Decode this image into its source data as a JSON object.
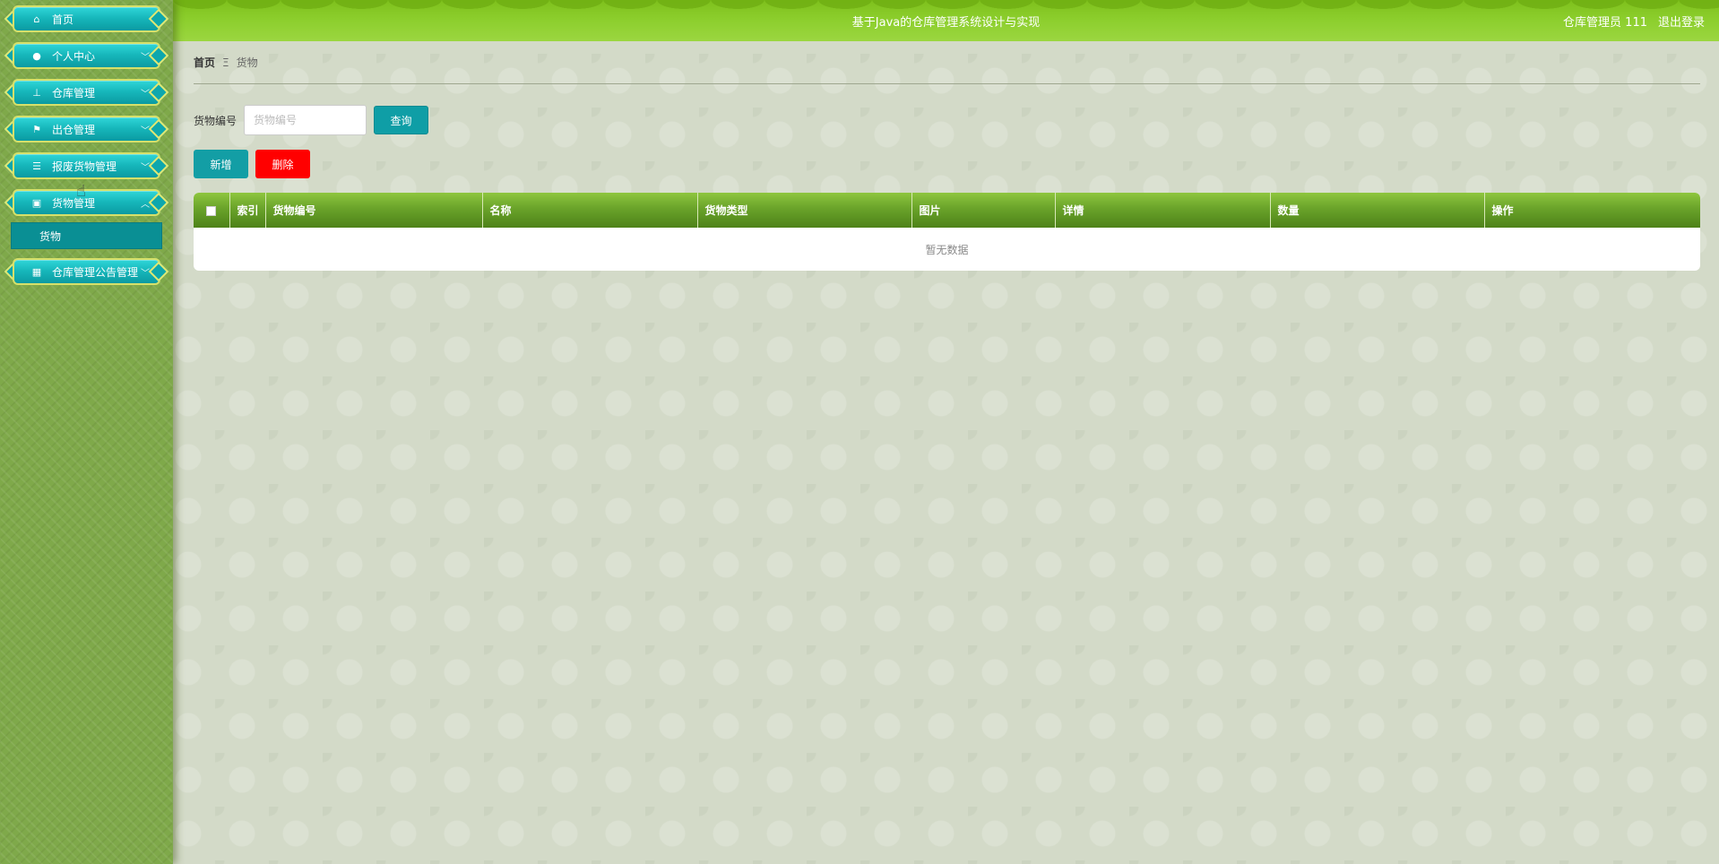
{
  "header": {
    "title": "基于Java的仓库管理系统设计与实现",
    "user": "仓库管理员 111",
    "logout": "退出登录"
  },
  "sidebar": {
    "items": [
      {
        "label": "首页",
        "icon": "home-icon",
        "expandable": false
      },
      {
        "label": "个人中心",
        "icon": "person-icon",
        "expandable": true
      },
      {
        "label": "仓库管理",
        "icon": "user-stamp-icon",
        "expandable": true
      },
      {
        "label": "出仓管理",
        "icon": "flag-icon",
        "expandable": true
      },
      {
        "label": "报废货物管理",
        "icon": "list-icon",
        "expandable": true
      },
      {
        "label": "货物管理",
        "icon": "clipboard-icon",
        "expandable": true,
        "expanded": true,
        "children": [
          {
            "label": "货物",
            "active": true
          }
        ]
      },
      {
        "label": "仓库管理公告管理",
        "icon": "grid-icon",
        "expandable": true
      }
    ]
  },
  "breadcrumb": {
    "home": "首页",
    "separator": "Ξ",
    "current": "货物"
  },
  "search": {
    "label": "货物编号",
    "placeholder": "货物编号",
    "value": "",
    "button": "查询"
  },
  "actions": {
    "add": "新增",
    "delete": "删除"
  },
  "table": {
    "columns": [
      "索引",
      "货物编号",
      "名称",
      "货物类型",
      "图片",
      "详情",
      "数量",
      "操作"
    ],
    "empty_text": "暂无数据",
    "rows": []
  },
  "colors": {
    "header_green": "#8dcf2e",
    "menu_teal": "#17b8bc",
    "delete_red": "#ff0000",
    "table_header_green": "#6aa32a"
  }
}
